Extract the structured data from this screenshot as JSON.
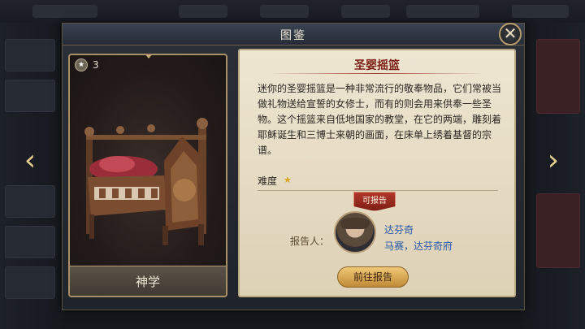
{
  "dialog": {
    "title": "图鉴",
    "close_glyph": "✕"
  },
  "item": {
    "stars": "3",
    "category": "神学"
  },
  "panel": {
    "title": "圣婴摇篮",
    "description": "迷你的圣婴摇篮是一种非常流行的敬奉物品，它们常被当做礼物送给宣誓的女修士，而有的则会用来供奉一些圣物。这个摇篮来自低地国家的教堂，在它的两端，雕刻着耶稣诞生和三博士来朝的画面，在床单上绣着基督的宗谱。",
    "difficulty_label": "难度",
    "difficulty_star": "★",
    "report_badge": "可报告",
    "reporter_label": "报告人：",
    "reporter_name": "达芬奇",
    "reporter_location": "马赛，达芬奇府",
    "go_button": "前往报告"
  },
  "nav": {
    "prev_glyph": "‹",
    "next_glyph": "›"
  },
  "colors": {
    "accent_gold": "#e7cf8f",
    "title_red": "#7a1e16",
    "reporter_blue": "#2456a8",
    "parchment": "#eee6d2"
  }
}
